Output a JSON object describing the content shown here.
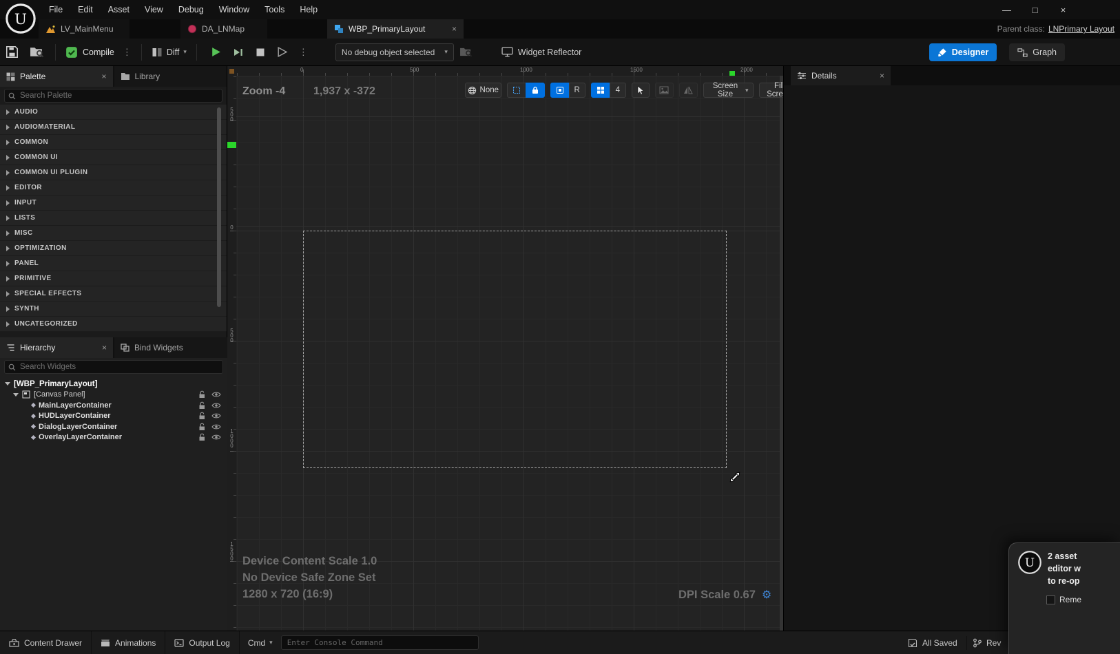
{
  "icons": {
    "close": "×",
    "caret_down": "▾",
    "kebab": "⋮",
    "gear": "⚙",
    "minimize": "—",
    "maximize": "□"
  },
  "colors": {
    "accent_blue": "#0070e0",
    "designer_blue": "#0b76d6",
    "play_green": "#57c357",
    "marker_green": "#2bd62b"
  },
  "menubar": {
    "items": [
      "File",
      "Edit",
      "Asset",
      "View",
      "Debug",
      "Window",
      "Tools",
      "Help"
    ]
  },
  "tabbar": {
    "tabs": [
      {
        "label": "LV_MainMenu"
      },
      {
        "label": "DA_LNMap"
      },
      {
        "label": "WBP_PrimaryLayout"
      }
    ],
    "parent_class_label": "Parent class:",
    "parent_class_value": "LNPrimary Layout"
  },
  "toolbar": {
    "compile_label": "Compile",
    "diff_label": "Diff",
    "debug_dropdown": "No debug object selected",
    "widget_reflector_label": "Widget Reflector",
    "designer_label": "Designer",
    "graph_label": "Graph"
  },
  "palette": {
    "tab_label": "Palette",
    "library_tab_label": "Library",
    "search_placeholder": "Search Palette",
    "categories": [
      "AUDIO",
      "AUDIOMATERIAL",
      "COMMON",
      "COMMON UI",
      "COMMON UI PLUGIN",
      "EDITOR",
      "INPUT",
      "LISTS",
      "MISC",
      "OPTIMIZATION",
      "PANEL",
      "PRIMITIVE",
      "SPECIAL EFFECTS",
      "SYNTH",
      "UNCATEGORIZED"
    ]
  },
  "hierarchy": {
    "tab_label": "Hierarchy",
    "bind_widgets_tab_label": "Bind Widgets",
    "search_placeholder": "Search Widgets",
    "root_label": "[WBP_PrimaryLayout]",
    "canvas_panel_label": "[Canvas Panel]",
    "children": [
      "MainLayerContainer",
      "HUDLayerContainer",
      "DialogLayerContainer",
      "OverlayLayerContainer"
    ]
  },
  "designer_canvas": {
    "zoom_label": "Zoom -4",
    "cursor_position": "1,937 x -372",
    "localization_preview": "None",
    "respect_locks_label": "R",
    "grid_snap_size": "4",
    "screen_size_label": "Screen Size",
    "fill_screen_label": "Fill Screen",
    "ruler_top_values": [
      "0",
      "500",
      "1000",
      "1500",
      "2000"
    ],
    "ruler_left_values": [
      "500",
      "0",
      "500",
      "1000",
      "1500"
    ],
    "device_content_scale": "Device Content Scale 1.0",
    "safe_zone_text": "No Device Safe Zone Set",
    "preview_resolution": "1280 x 720 (16:9)",
    "dpi_scale": "DPI Scale 0.67"
  },
  "details": {
    "tab_label": "Details"
  },
  "statusbar": {
    "content_drawer_label": "Content Drawer",
    "animations_label": "Animations",
    "output_log_label": "Output Log",
    "cmd_label": "Cmd",
    "console_placeholder": "Enter Console Command",
    "all_saved_label": "All Saved",
    "revision_label": "Rev"
  },
  "notification": {
    "line1": "2 asset",
    "line2": "editor w",
    "line3": "to re-op",
    "checkbox_label": "Reme"
  }
}
